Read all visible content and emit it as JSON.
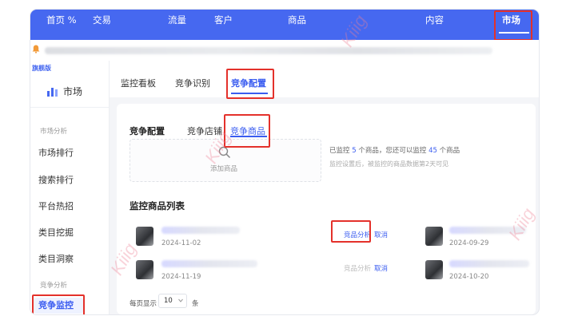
{
  "topnav": {
    "items": [
      {
        "label": "首页 %"
      },
      {
        "label": "交易"
      },
      {
        "label": "流量"
      },
      {
        "label": "客户"
      },
      {
        "label": "商品"
      },
      {
        "label": "内容"
      },
      {
        "label": "市场",
        "active": true
      }
    ]
  },
  "sidebar": {
    "brand_tag": "旗舰版",
    "brand_label": "市场",
    "group1": "市场分析",
    "items1": [
      {
        "label": "市场排行"
      },
      {
        "label": "搜索排行"
      },
      {
        "label": "平台热招"
      },
      {
        "label": "类目挖掘"
      },
      {
        "label": "类目洞察"
      }
    ],
    "group2": "竞争分析",
    "active_item": "竞争监控"
  },
  "main_tabs": [
    {
      "label": "监控看板"
    },
    {
      "label": "竞争识别"
    },
    {
      "label": "竞争配置",
      "active": true
    }
  ],
  "sub_tabs": [
    {
      "label": "竞争配置"
    },
    {
      "label": "竞争店铺"
    },
    {
      "label": "竞争商品",
      "active": true
    }
  ],
  "add_box": {
    "label": "添加商品"
  },
  "monitor": {
    "prefix": "已监控",
    "count": "5",
    "middle": "个商品，您还可以监控",
    "remaining": "45",
    "suffix": "个商品",
    "note": "监控设置后，被监控的商品数据第2天可见"
  },
  "list_title": "监控商品列表",
  "products": [
    {
      "date": "2024-11-02",
      "analysis_label": "竞品分析",
      "cancel_label": "取消"
    },
    {
      "date": "2024-11-19",
      "analysis_label": "竞品分析",
      "cancel_label": "取消"
    },
    {
      "date": "2024-09-29"
    },
    {
      "date": "2024-10-20"
    }
  ],
  "pager": {
    "prefix": "每页显示",
    "value": "10",
    "suffix": "条"
  },
  "watermark_text": "Kiiig",
  "colors": {
    "primary": "#4668f0",
    "highlight": "#e4312b",
    "link": "#3a5cf0"
  }
}
